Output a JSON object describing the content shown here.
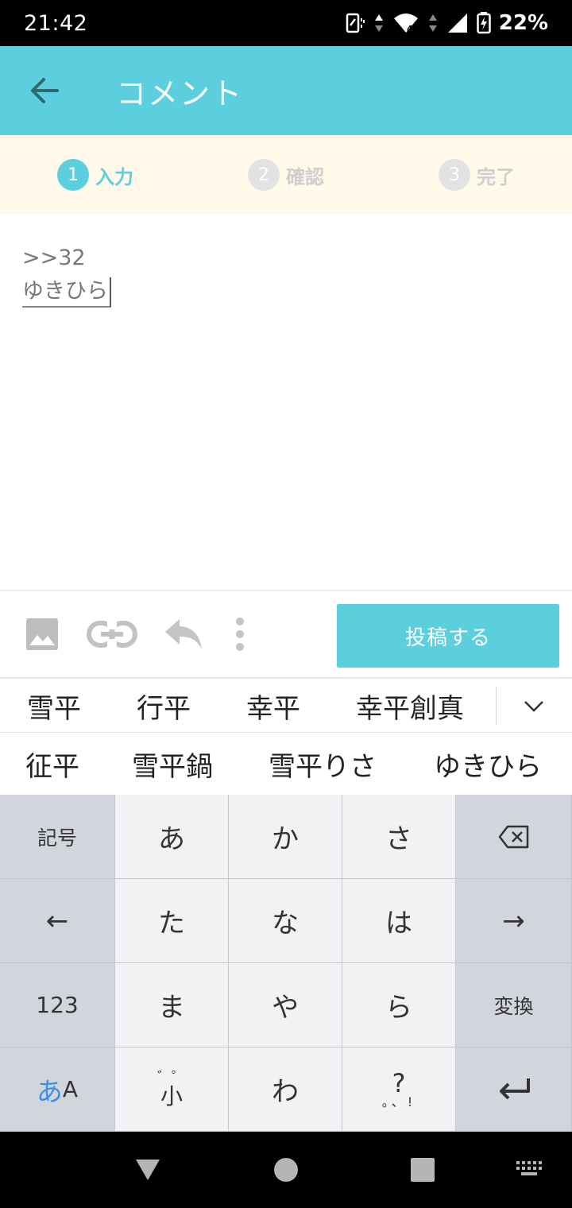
{
  "status": {
    "time": "21:42",
    "battery": "22%"
  },
  "app_bar": {
    "title": "コメント"
  },
  "steps": [
    {
      "num": "1",
      "label": "入力"
    },
    {
      "num": "2",
      "label": "確認"
    },
    {
      "num": "3",
      "label": "完了"
    }
  ],
  "editor": {
    "reply_ref": ">>32",
    "composing": "ゆきひら"
  },
  "toolbar": {
    "post_label": "投稿する"
  },
  "candidates": {
    "row1": [
      "雪平",
      "行平",
      "幸平",
      "幸平創真"
    ],
    "row2": [
      "征平",
      "雪平鍋",
      "雪平りさ",
      "ゆきひら"
    ]
  },
  "keyboard": {
    "symbols": "記号",
    "a": "あ",
    "ka": "か",
    "sa": "さ",
    "left": "←",
    "ta": "た",
    "na": "な",
    "ha": "は",
    "right": "→",
    "num": "123",
    "ma": "ま",
    "ya": "や",
    "ra": "ら",
    "convert": "変換",
    "ime_a": "あ",
    "ime_b": "A",
    "small_top": "゛゜",
    "small": "小",
    "wa": "わ",
    "punct_q": "?",
    "punct_rest": "。、!"
  },
  "colors": {
    "accent": "#5ccfdf",
    "stepper_bg": "#fff9ea"
  }
}
